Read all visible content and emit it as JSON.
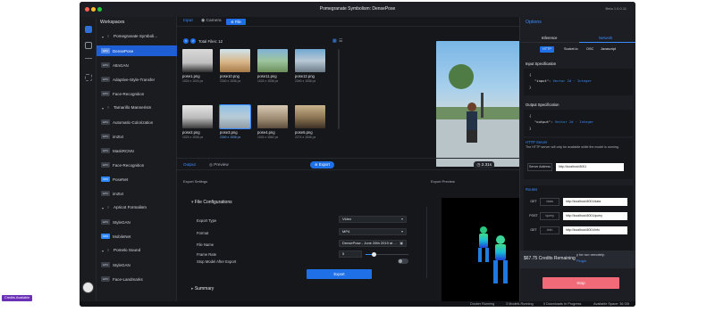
{
  "window": {
    "title": "Pomegranate Symbolism: DensePose",
    "beta": "Beta 1.0.0.11"
  },
  "sidebar": {
    "heading": "Workspaces",
    "workspaces": [
      {
        "name": "Pomegranate Symboli...",
        "models": [
          {
            "tag": "GPU",
            "name": "DensePose",
            "selected": true
          },
          {
            "tag": "GPU",
            "name": "AttnGAN"
          },
          {
            "tag": "GPU",
            "name": "Adaptive-Style-Transfer"
          },
          {
            "tag": "GPU",
            "name": "Face-Recognition"
          }
        ]
      },
      {
        "name": "Tamarillo Mannerism",
        "models": [
          {
            "tag": "GPU",
            "name": "Automatic-Colorization"
          },
          {
            "tag": "GPU",
            "name": "im2txt"
          },
          {
            "tag": "GPU",
            "name": "MaskRCNN"
          },
          {
            "tag": "GPU",
            "name": "Face-Recognition"
          },
          {
            "tag": "CPU",
            "name": "PoseNet"
          },
          {
            "tag": "GPU",
            "name": "im2txt"
          }
        ]
      },
      {
        "name": "Apricot Formalism",
        "models": [
          {
            "tag": "GPU",
            "name": "StyleGAN"
          },
          {
            "tag": "CPU",
            "name": "MobileNet"
          }
        ]
      },
      {
        "name": "Pomelo Sound",
        "models": [
          {
            "tag": "GPU",
            "name": "StyleGAN"
          },
          {
            "tag": "GPU",
            "name": "Face-Landmarks"
          }
        ]
      }
    ],
    "credits_badge": "Credits Available"
  },
  "input_tabs": {
    "input": "Input",
    "camera": "Camera",
    "file": "File"
  },
  "files": {
    "prev": "<",
    "next": ">",
    "total": "Total Files: 12",
    "items": [
      {
        "name": "pose1.png",
        "size": "1024 x 1024 px"
      },
      {
        "name": "pose10.png",
        "size": "2340 x 1536 px"
      },
      {
        "name": "pose11.png",
        "size": "1024 x 1536 px"
      },
      {
        "name": "pose12.png",
        "size": "2340 x 1536 px"
      },
      {
        "name": "pose2.png",
        "size": "1024 x 1536 px"
      },
      {
        "name": "pose3.png",
        "size": "2340 x 1536 px",
        "selected": true
      },
      {
        "name": "pose4.png",
        "size": "1024 x 1562 px"
      },
      {
        "name": "pose5.png",
        "size": "2274 x 1536 px"
      }
    ]
  },
  "output_bar": {
    "output": "Output",
    "preview": "Preview",
    "export": "Export",
    "timer": "2.31s"
  },
  "export_settings": {
    "heading": "Export Settings",
    "section": "File Configurations",
    "export_type_label": "Export Type",
    "export_type_value": "Video",
    "format_label": "Format",
    "format_value": "MP4",
    "filename_label": "File Name",
    "filename_value": "DensePose - June 26th 2019 at ...",
    "framerate_label": "Frame Rate",
    "framerate_value": "5",
    "stop_label": "Stop Model After Export",
    "export_button": "Export",
    "summary": "Summary"
  },
  "export_preview": {
    "heading": "Export Preview"
  },
  "options": {
    "heading": "Options",
    "tabs": [
      "Inference",
      "Network"
    ],
    "formats": [
      "HTTP",
      "Socket.io",
      "OSC",
      "Javascript"
    ],
    "input_spec": {
      "title": "Input Specification",
      "open": "{",
      "key": "\"input\":",
      "type": "Vector 2d · Integer",
      "close": "}"
    },
    "output_spec": {
      "title": "Output Specification",
      "open": "{",
      "key": "\"output\":",
      "type": "Vector 2d · Integer",
      "close": "}"
    },
    "http": {
      "title": "HTTP Server",
      "desc": "The HTTP server will only be available while the model is running.",
      "server_label": "Server Address",
      "server_url": "http://localhost:8001"
    },
    "routes": {
      "title": "Routes",
      "items": [
        {
          "method": "GET",
          "name": "/data",
          "url": "http://localhost:8001/data"
        },
        {
          "method": "POST",
          "name": "/query",
          "url": "http://localhost:8001/query"
        },
        {
          "method": "GET",
          "name": "/info",
          "url": "http://localhost:8001/info"
        }
      ]
    },
    "remaining": {
      "amount": "$67.75 Credits Remaining",
      "note": "y be run remotely.",
      "link": "Plugin"
    },
    "stop_button": "Stop"
  },
  "statusbar": {
    "docker": "Docker Running",
    "models": "3 Models Running",
    "downloads": "0 Downloads In Progress",
    "space": "Available Space: 36 GB"
  },
  "colors": {
    "accent": "#1f6fe6",
    "window_bg": "#15171b",
    "stop": "#f06a78",
    "credits": "#6b2fb8"
  }
}
